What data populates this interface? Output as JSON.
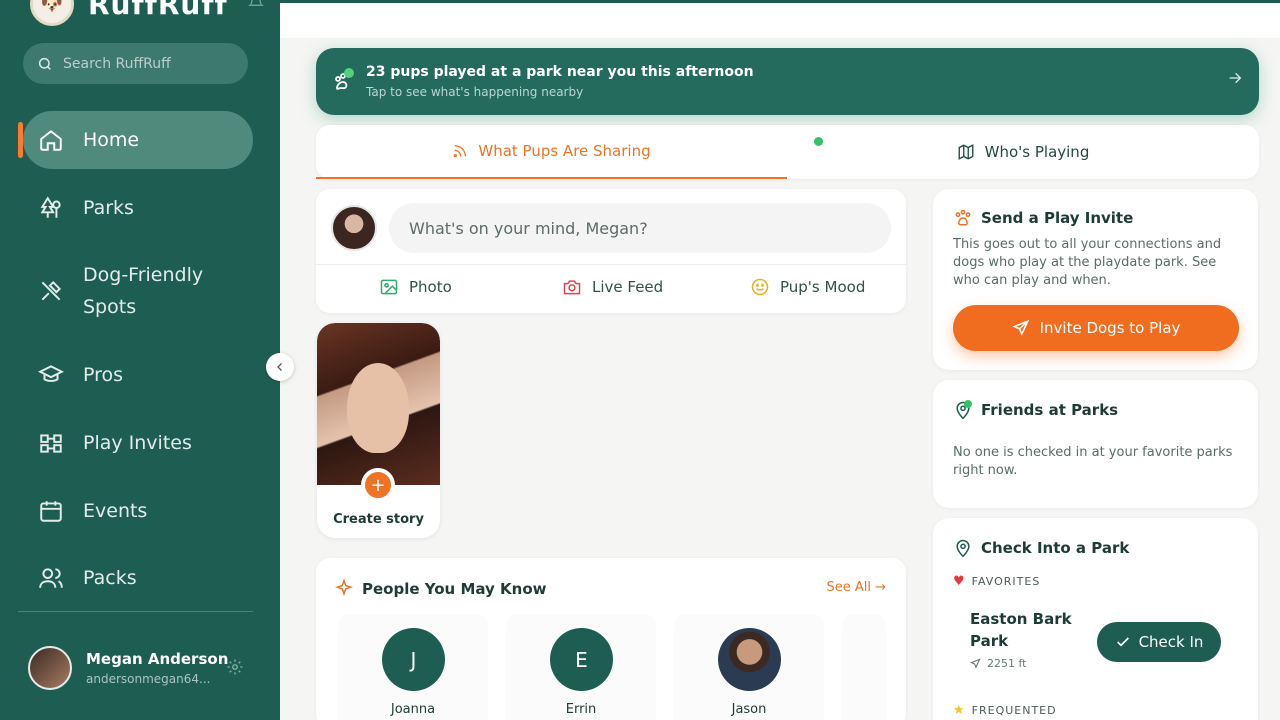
{
  "app": {
    "name": "RuffRuff"
  },
  "sidebar": {
    "search_placeholder": "Search RuffRuff",
    "items": [
      {
        "label": "Home",
        "icon": "home-icon",
        "active": true
      },
      {
        "label": "Parks",
        "icon": "park-icon"
      },
      {
        "label": "Dog-Friendly",
        "label2": "Spots",
        "icon": "utensils-icon"
      },
      {
        "label": "Pros",
        "icon": "graduation-cap-icon"
      },
      {
        "label": "Play Invites",
        "icon": "play-invites-icon"
      },
      {
        "label": "Events",
        "icon": "calendar-icon"
      },
      {
        "label": "Packs",
        "icon": "people-icon"
      }
    ],
    "profile": {
      "name": "Megan Anderson",
      "handle": "andersonmegan64..."
    }
  },
  "banner": {
    "title": "23 pups played at a park near you this afternoon",
    "subtitle": "Tap to see what's happening nearby"
  },
  "tabs": [
    {
      "label": "What Pups Are Sharing",
      "active": true
    },
    {
      "label": "Who's Playing"
    }
  ],
  "composer": {
    "placeholder": "What's on your mind, Megan?",
    "actions": [
      {
        "label": "Photo",
        "icon": "photo-icon"
      },
      {
        "label": "Live Feed",
        "icon": "camera-icon"
      },
      {
        "label": "Pup's Mood",
        "icon": "smiley-icon"
      }
    ]
  },
  "story": {
    "label": "Create story"
  },
  "pymk": {
    "title": "People You May Know",
    "see_all": "See All",
    "people": [
      {
        "initial": "J",
        "name": "Joanna"
      },
      {
        "initial": "E",
        "name": "Errin"
      },
      {
        "initial": "",
        "name": "Jason"
      }
    ]
  },
  "play_invite": {
    "title": "Send a Play Invite",
    "text": "This goes out to all your connections and dogs who play at the playdate park. See who can play and when.",
    "button": "Invite Dogs to Play"
  },
  "friends_at_parks": {
    "title": "Friends at Parks",
    "text": "No one is checked in at your favorite parks right now."
  },
  "check_in": {
    "title": "Check Into a Park",
    "favorites_label": "FAVORITES",
    "park_name": "Easton Bark Park",
    "park_distance": "2251 ft",
    "button": "Check In",
    "frequented_label": "FREQUENTED"
  },
  "colors": {
    "sidebar": "#1e5e52",
    "accent": "#ee7325",
    "active_nav": "#4f8a7d",
    "online": "#35c36a"
  }
}
